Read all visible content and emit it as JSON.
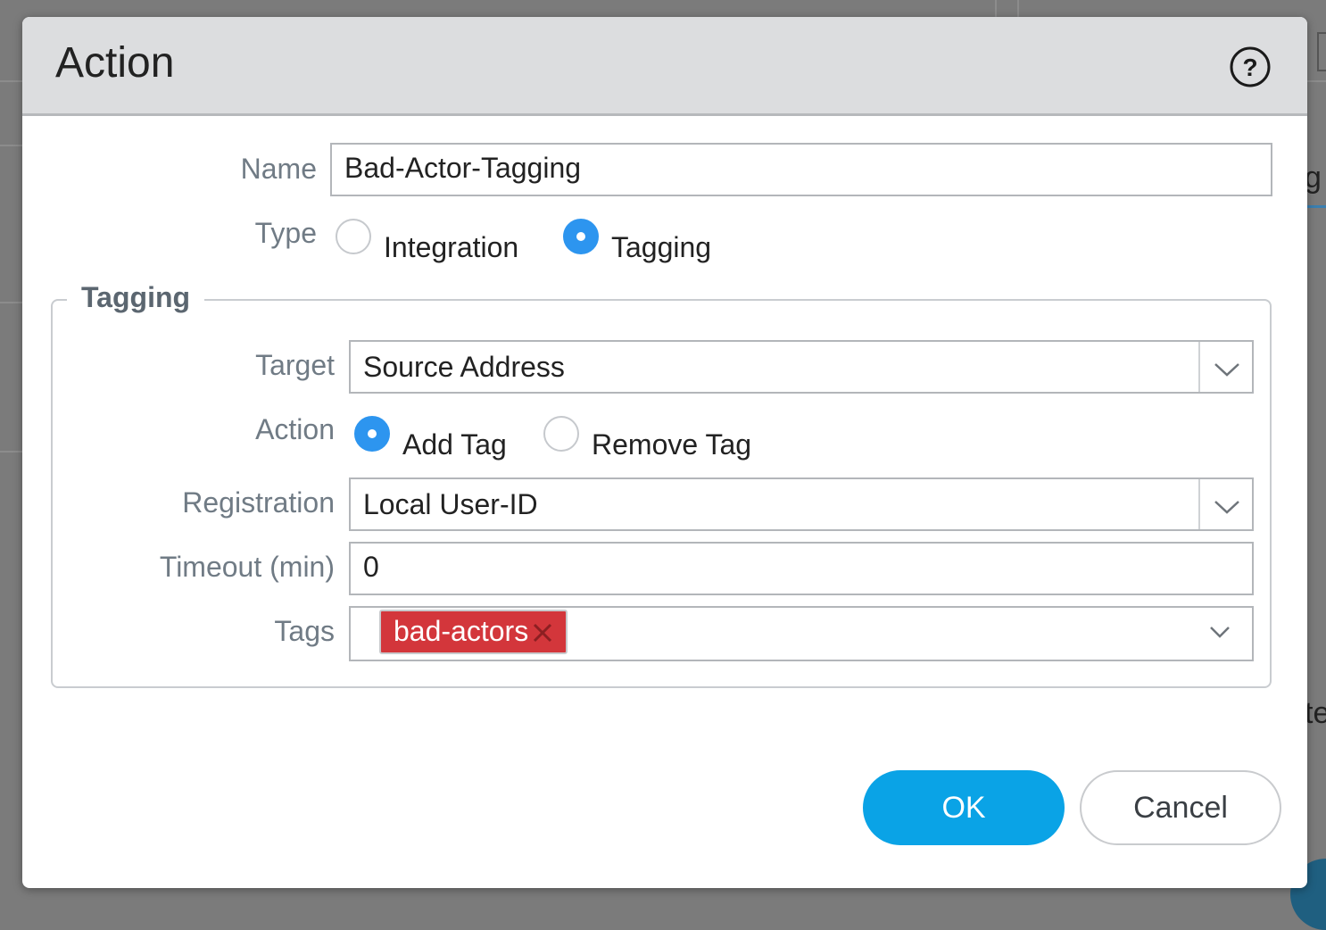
{
  "dialog": {
    "title": "Action",
    "help_icon": "question-circle-icon"
  },
  "form": {
    "name_label": "Name",
    "name_value": "Bad-Actor-Tagging",
    "type_label": "Type",
    "type_options": [
      {
        "label": "Integration",
        "selected": false
      },
      {
        "label": "Tagging",
        "selected": true
      }
    ]
  },
  "tagging": {
    "legend": "Tagging",
    "target_label": "Target",
    "target_value": "Source Address",
    "action_label": "Action",
    "action_options": [
      {
        "label": "Add Tag",
        "selected": true
      },
      {
        "label": "Remove Tag",
        "selected": false
      }
    ],
    "registration_label": "Registration",
    "registration_value": "Local User-ID",
    "timeout_label": "Timeout (min)",
    "timeout_value": "0",
    "tags_label": "Tags",
    "tags": [
      {
        "label": "bad-actors",
        "color": "#d3363b"
      }
    ]
  },
  "buttons": {
    "ok": "OK",
    "cancel": "Cancel"
  },
  "background": {
    "partial_text_1": "g",
    "partial_text_2": "te"
  },
  "colors": {
    "accent": "#0aa3e6",
    "radio_selected": "#2d95ef",
    "tag_red": "#d3363b"
  }
}
